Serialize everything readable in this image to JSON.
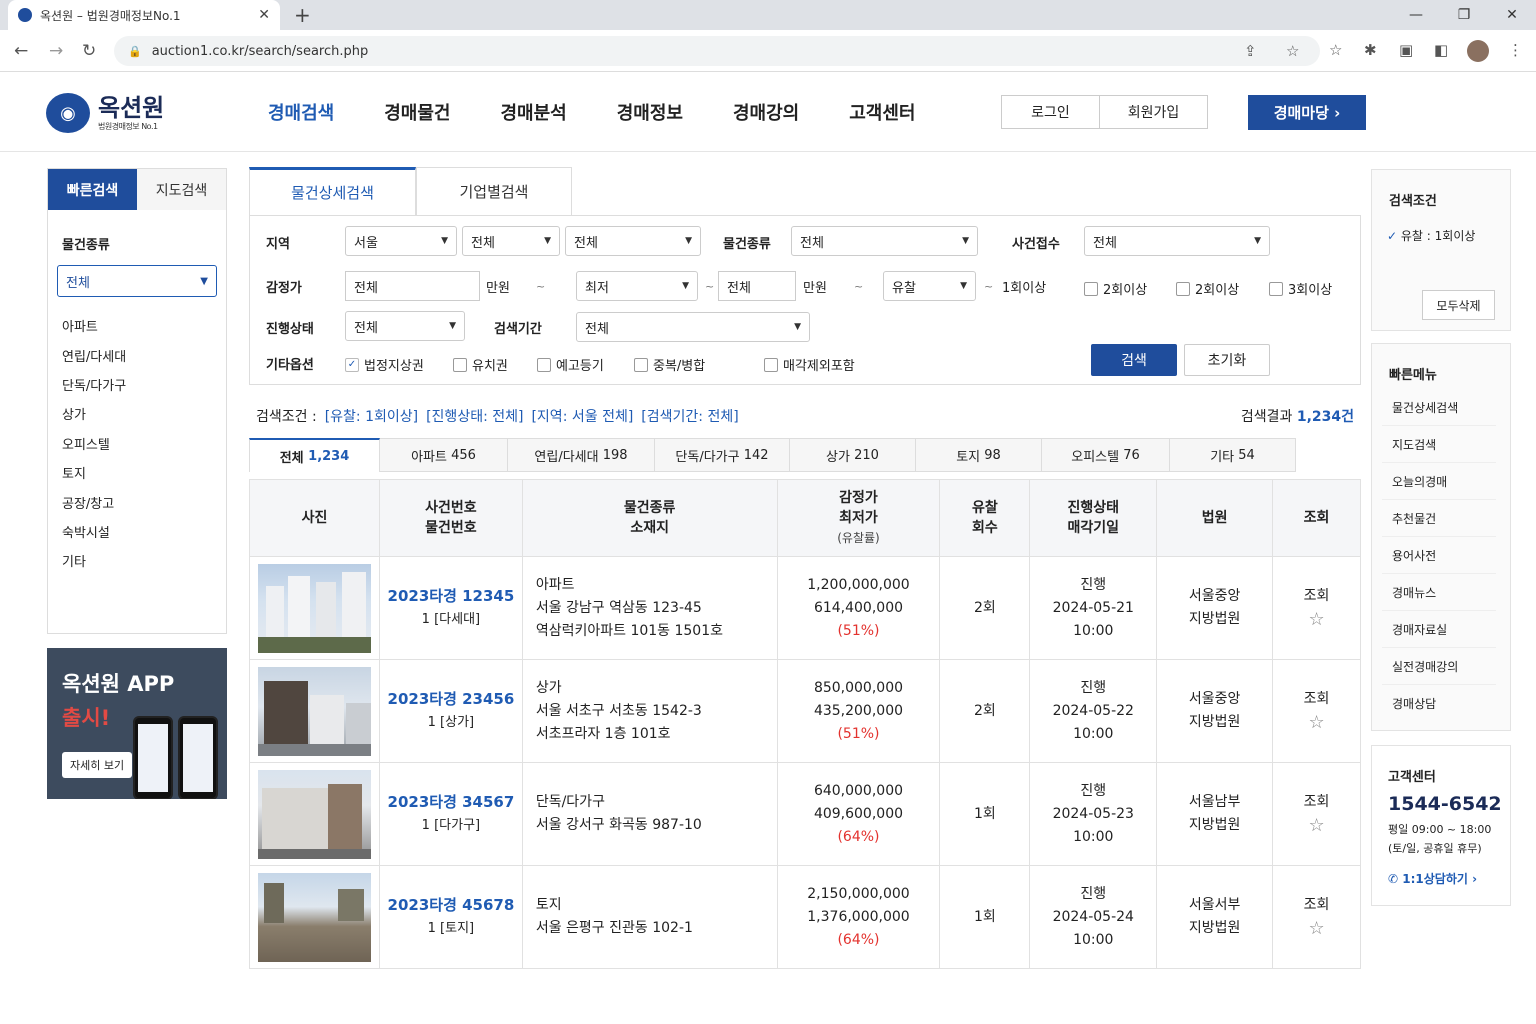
{
  "browser": {
    "tab_title": "옥션원 – 법원경매정보No.1",
    "url": "auction1.co.kr/search/search.php"
  },
  "header": {
    "logo_name": "옥션원",
    "logo_sub": "법원경매정보 No.1",
    "nav": [
      "경매검색",
      "경매물건",
      "경매분석",
      "경매정보",
      "경매강의",
      "고객센터"
    ],
    "login": "로그인",
    "signup": "회원가입",
    "main_button": "경매마당  ›"
  },
  "left": {
    "tabs": [
      "빠른검색",
      "지도검색"
    ],
    "section": "물건종류",
    "select_value": "전체",
    "items": [
      "아파트",
      "연립/다세대",
      "단독/다가구",
      "상가",
      "오피스텔",
      "토지",
      "공장/창고",
      "숙박시설",
      "기타"
    ],
    "app_title": "옥션원 APP",
    "app_sub": "출시!",
    "app_more": "자세히 보기"
  },
  "search": {
    "tabs": [
      "물건상세검색",
      "기업별검색"
    ],
    "region_label": "지역",
    "region": [
      "서울",
      "전체",
      "전체"
    ],
    "type_label": "물건종류",
    "type_value": "전체",
    "case_label": "사건접수",
    "case_value": "전체",
    "appraisal_label": "감정가",
    "appraisal_from": "전체",
    "appraisal_unit": "만원",
    "appraisal_sel": "최저",
    "appraisal_to": "전체",
    "appraisal_unit2": "만원",
    "fail_sel": "유찰",
    "fail_min": "1회이상",
    "fail_checks": [
      "2회이상",
      "2회이상",
      "3회이상"
    ],
    "status_label": "진행상태",
    "status_value": "전체",
    "period_label": "검색기간",
    "period_value": "전체",
    "options_label": "기타옵션",
    "options": [
      "법정지상권",
      "유치권",
      "예고등기",
      "중복/병합",
      "매각제외포함"
    ],
    "search_btn": "검색",
    "reset_btn": "초기화"
  },
  "conditions": {
    "label": "검색조건 :",
    "items": [
      "[유찰: 1회이상]",
      "[진행상태: 전체]",
      "[지역: 서울 전체]",
      "[검색기간: 전체]"
    ],
    "result_label": "검색결과",
    "result_count": "1,234건"
  },
  "categories": [
    {
      "name": "전체",
      "count": "1,234"
    },
    {
      "name": "아파트",
      "count": "456"
    },
    {
      "name": "연립/다세대",
      "count": "198"
    },
    {
      "name": "단독/다가구",
      "count": "142"
    },
    {
      "name": "상가",
      "count": "210"
    },
    {
      "name": "토지",
      "count": "98"
    },
    {
      "name": "오피스텔",
      "count": "76"
    },
    {
      "name": "기타",
      "count": "54"
    }
  ],
  "table": {
    "headers": {
      "photo": "사진",
      "case1": "사건번호",
      "case2": "물건번호",
      "type1": "물건종류",
      "type2": "소재지",
      "price1": "감정가",
      "price2": "최저가",
      "price3": "(유찰률)",
      "fail1": "유찰",
      "fail2": "회수",
      "status1": "진행상태",
      "status2": "매각기일",
      "court": "법원",
      "view": "조회"
    },
    "rows": [
      {
        "case": "2023타경 12345",
        "item": "1 [다세대]",
        "type": "아파트",
        "addr1": "서울 강남구 역삼동 123-45",
        "addr2": "역삼럭키아파트 101동 1501호",
        "appraisal": "1,200,000,000",
        "minimum": "614,400,000",
        "rate": "(51%)",
        "fail": "2회",
        "status": "진행",
        "date": "2024-05-21",
        "time": "10:00",
        "court1": "서울중앙",
        "court2": "지방법원",
        "view": "조회"
      },
      {
        "case": "2023타경 23456",
        "item": "1 [상가]",
        "type": "상가",
        "addr1": "서울 서초구 서초동 1542-3",
        "addr2": "서초프라자 1층 101호",
        "appraisal": "850,000,000",
        "minimum": "435,200,000",
        "rate": "(51%)",
        "fail": "2회",
        "status": "진행",
        "date": "2024-05-22",
        "time": "10:00",
        "court1": "서울중앙",
        "court2": "지방법원",
        "view": "조회"
      },
      {
        "case": "2023타경 34567",
        "item": "1 [다가구]",
        "type": "단독/다가구",
        "addr1": "서울 강서구 화곡동 987-10",
        "addr2": "",
        "appraisal": "640,000,000",
        "minimum": "409,600,000",
        "rate": "(64%)",
        "fail": "1회",
        "status": "진행",
        "date": "2024-05-23",
        "time": "10:00",
        "court1": "서울남부",
        "court2": "지방법원",
        "view": "조회"
      },
      {
        "case": "2023타경 45678",
        "item": "1 [토지]",
        "type": "토지",
        "addr1": "서울 은평구 진관동 102-1",
        "addr2": "",
        "appraisal": "2,150,000,000",
        "minimum": "1,376,000,000",
        "rate": "(64%)",
        "fail": "1회",
        "status": "진행",
        "date": "2024-05-24",
        "time": "10:00",
        "court1": "서울서부",
        "court2": "지방법원",
        "view": "조회"
      }
    ]
  },
  "right": {
    "cond_title": "검색조건",
    "cond_item": "유찰 : 1회이상",
    "clear_all": "모두삭제",
    "quick_title": "빠른메뉴",
    "quick": [
      "물건상세검색",
      "지도검색",
      "오늘의경매",
      "추천물건",
      "용어사전",
      "경매뉴스",
      "경매자료실",
      "실전경매강의",
      "경매상담"
    ],
    "cs_title": "고객센터",
    "cs_phone": "1544-6542",
    "cs_hours1": "평일 09:00 ~ 18:00",
    "cs_hours2": "(토/일, 공휴일 휴무)",
    "cs_link": "1:1상담하기"
  },
  "colors": {
    "brand": "#1f4d9c",
    "accent": "#1f5bb3",
    "rate": "#e3322e"
  }
}
